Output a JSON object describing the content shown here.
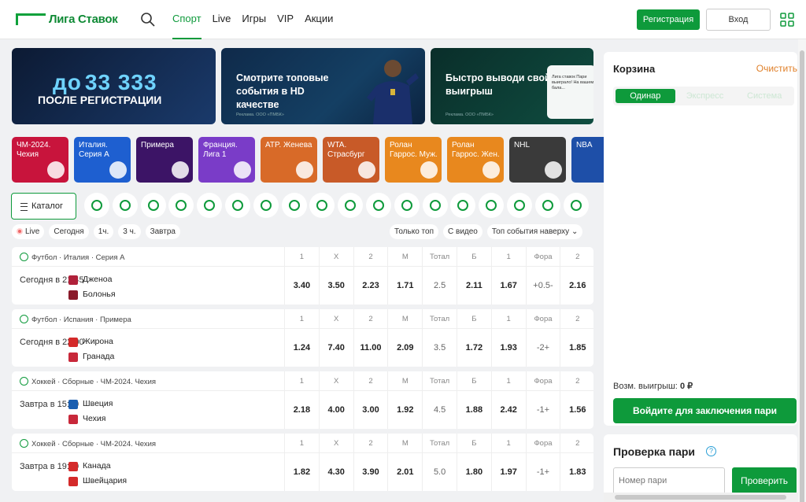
{
  "header": {
    "logo": "Лига Ставок",
    "nav": [
      "Спорт",
      "Live",
      "Игры",
      "VIP",
      "Акции"
    ],
    "register": "Регистрация",
    "login": "Вход"
  },
  "banners": [
    {
      "top": "до",
      "amount": "33 333",
      "bottom": "ПОСЛЕ РЕГИСТРАЦИИ"
    },
    {
      "text": "Смотрите топовые события в HD качестве",
      "small": "Реклама. ООО «ПМБК»"
    },
    {
      "text": "Быстро выводи свой выигрыш",
      "small": "Реклама. ООО «ПМБК»",
      "phone": "Лига ставок Пари выиграло! На вашем бала..."
    }
  ],
  "chips": [
    {
      "label": "ЧМ-2024. Чехия",
      "color": "#c8143c"
    },
    {
      "label": "Италия. Серия А",
      "color": "#1e5fd0"
    },
    {
      "label": "Примера",
      "color": "#3c1466"
    },
    {
      "label": "Франция. Лига 1",
      "color": "#7a3cc8"
    },
    {
      "label": "ATP. Женева",
      "color": "#d86a28"
    },
    {
      "label": "WTA. Страсбург",
      "color": "#c85a28"
    },
    {
      "label": "Ролан Гаррос. Муж.",
      "color": "#e8881e"
    },
    {
      "label": "Ролан Гаррос. Жен.",
      "color": "#e8881e"
    },
    {
      "label": "NHL",
      "color": "#3a3a3a"
    },
    {
      "label": "NBA",
      "color": "#1e4fa8"
    }
  ],
  "catalog": "Каталог",
  "sports_count": 18,
  "filters": [
    "Live",
    "Сегодня",
    "1ч.",
    "3 ч.",
    "Завтра"
  ],
  "filters_right": [
    "Только топ",
    "С видео",
    "Топ события наверху"
  ],
  "odds_headers": [
    "1",
    "X",
    "2",
    "М",
    "Тотал",
    "Б",
    "1",
    "Фора",
    "2"
  ],
  "events": [
    {
      "league": "Футбол · Италия · Серия А",
      "time": "Сегодня в 21:45",
      "team1": "Дженоа",
      "team2": "Болонья",
      "flag1": "#b0213a",
      "flag2": "#8a1a2a",
      "odds": [
        "3.40",
        "3.50",
        "2.23",
        "1.71",
        "2.5",
        "2.11",
        "1.67",
        "+0.5-",
        "2.16"
      ]
    },
    {
      "league": "Футбол · Испания · Примера",
      "time": "Сегодня в 22:00",
      "team1": "Жирона",
      "team2": "Гранада",
      "flag1": "#d42a2a",
      "flag2": "#c8283a",
      "odds": [
        "1.24",
        "7.40",
        "11.00",
        "2.09",
        "3.5",
        "1.72",
        "1.93",
        "-2+",
        "1.85"
      ]
    },
    {
      "league": "Хоккей · Сборные · ЧМ-2024. Чехия",
      "time": "Завтра в 15:20",
      "team1": "Швеция",
      "team2": "Чехия",
      "flag1": "#1a5eb0",
      "flag2": "#c8283a",
      "odds": [
        "2.18",
        "4.00",
        "3.00",
        "1.92",
        "4.5",
        "1.88",
        "2.42",
        "-1+",
        "1.56"
      ]
    },
    {
      "league": "Хоккей · Сборные · ЧМ-2024. Чехия",
      "time": "Завтра в 19:20",
      "team1": "Канада",
      "team2": "Швейцария",
      "flag1": "#d42a2a",
      "flag2": "#d42a2a",
      "odds": [
        "1.82",
        "4.30",
        "3.90",
        "2.01",
        "5.0",
        "1.80",
        "1.97",
        "-1+",
        "1.83"
      ]
    }
  ],
  "cart": {
    "title": "Корзина",
    "clear": "Очистить",
    "tabs": [
      "Одинар",
      "Экспресс",
      "Система"
    ],
    "win_label": "Возм. выигрыш:",
    "win_value": "0 ₽",
    "place": "Войдите для заключения пари"
  },
  "check": {
    "title": "Проверка пари",
    "placeholder": "Номер пари",
    "button": "Проверить"
  }
}
